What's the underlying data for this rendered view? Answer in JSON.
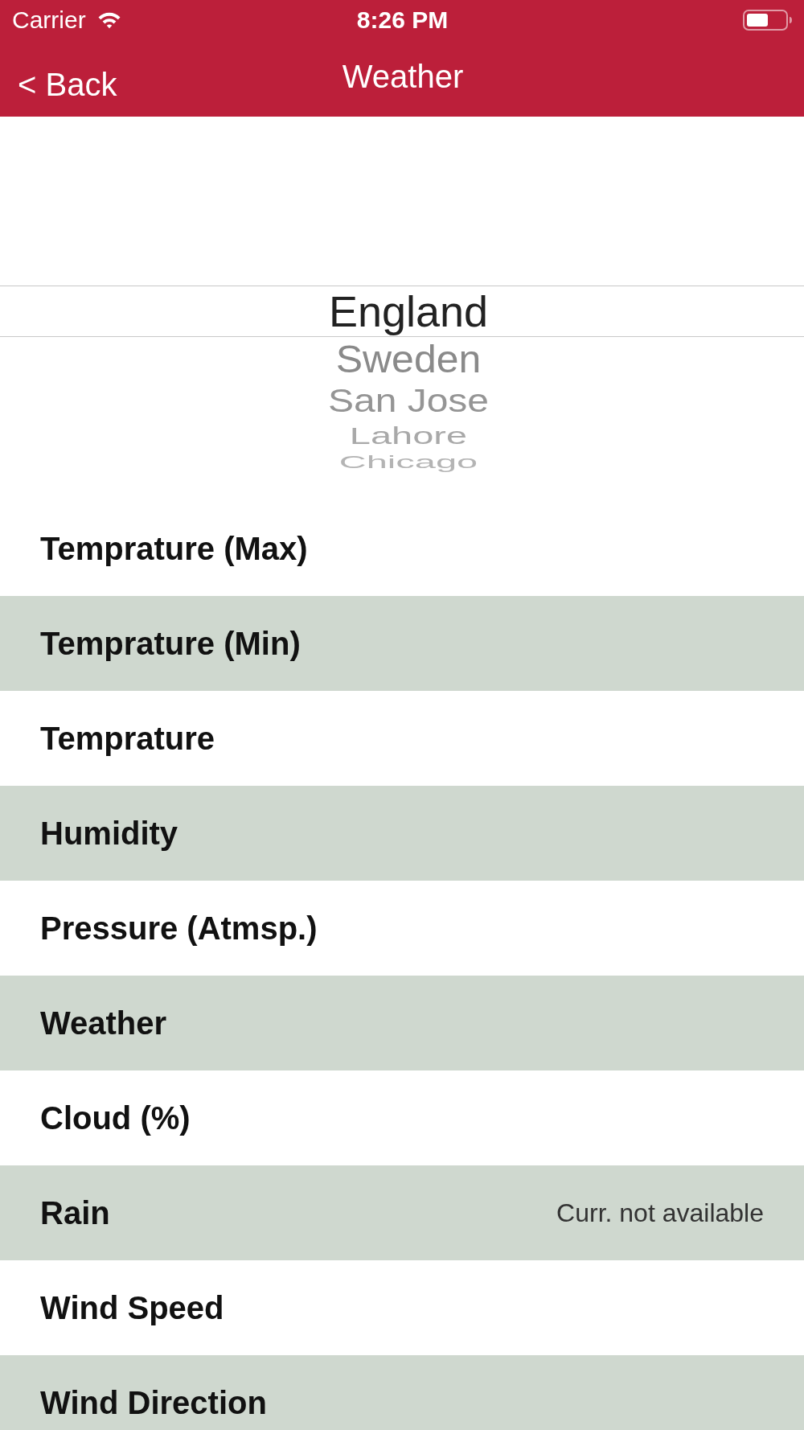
{
  "status_bar": {
    "carrier": "Carrier",
    "time": "8:26 PM"
  },
  "nav_bar": {
    "back": "< Back",
    "title": "Weather"
  },
  "picker": {
    "items": [
      {
        "label": "England",
        "selected": true
      },
      {
        "label": "Sweden",
        "selected": false
      },
      {
        "label": "San Jose",
        "selected": false
      },
      {
        "label": "Lahore",
        "selected": false
      },
      {
        "label": "Chicago",
        "selected": false
      }
    ]
  },
  "rows": [
    {
      "label": "Temprature (Max)"
    },
    {
      "label": "Temprature (Min)"
    },
    {
      "label": "Temprature"
    },
    {
      "label": "Humidity"
    },
    {
      "label": "Pressure (Atmsp.)"
    },
    {
      "label": "Weather"
    },
    {
      "label": "Cloud (%)"
    },
    {
      "label": "Rain",
      "value": "Curr. not available"
    },
    {
      "label": "Wind Speed"
    },
    {
      "label": "Wind Direction"
    }
  ]
}
